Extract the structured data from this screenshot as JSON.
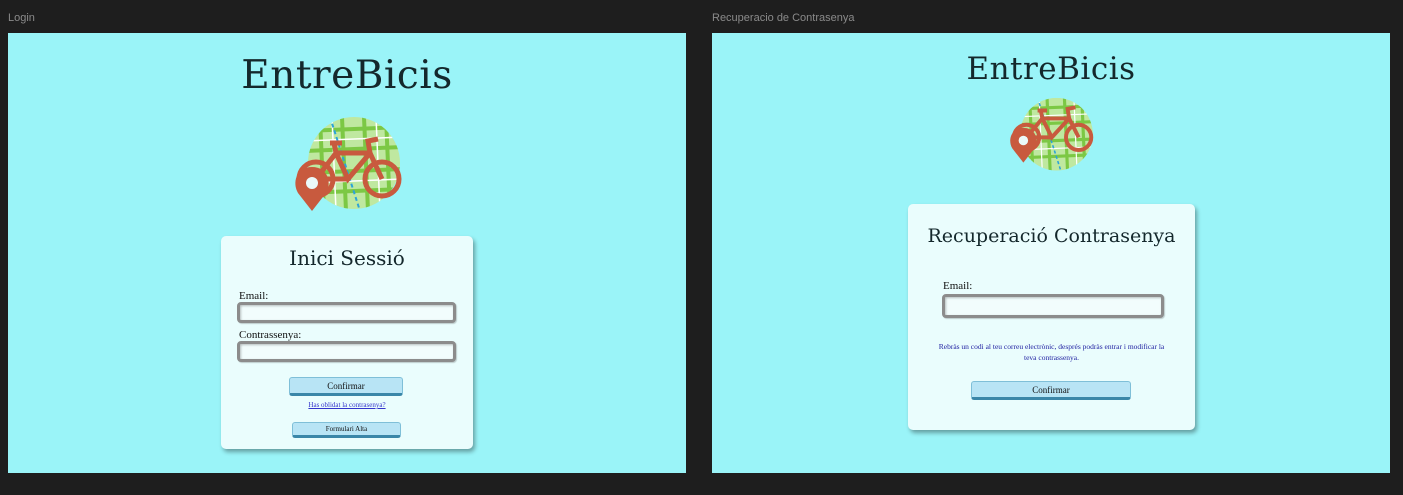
{
  "frames": {
    "login": {
      "label": "Login",
      "app_title": "EntreBicis",
      "logo_icon": "bike-map-pin-logo",
      "card": {
        "title": "Inici Sessió",
        "email_label": "Email:",
        "email_value": "",
        "password_label": "Contrassenya:",
        "password_value": "",
        "confirm_button": "Confirmar",
        "forgot_link": "Has oblidat la contrasenya?",
        "signup_button": "Formulari Alta"
      }
    },
    "recovery": {
      "label": "Recuperacio de Contrasenya",
      "app_title": "EntreBicis",
      "logo_icon": "bike-map-pin-logo",
      "card": {
        "title": "Recuperació Contrasenya",
        "email_label": "Email:",
        "email_value": "",
        "info_text": "Rebràs un codi al teu correu electrònic, després podràs entrar i modificar la teva contrassenya.",
        "confirm_button": "Confirmar"
      }
    }
  },
  "colors": {
    "canvas_bg": "#1e1e1e",
    "frame_bg": "#9af4f8",
    "card_bg": "#eafdfd",
    "button_bg": "#b8e4f5",
    "logo_red": "#c85a3e",
    "map_green": "#8fd65a",
    "info_text": "#1c1ca0"
  }
}
